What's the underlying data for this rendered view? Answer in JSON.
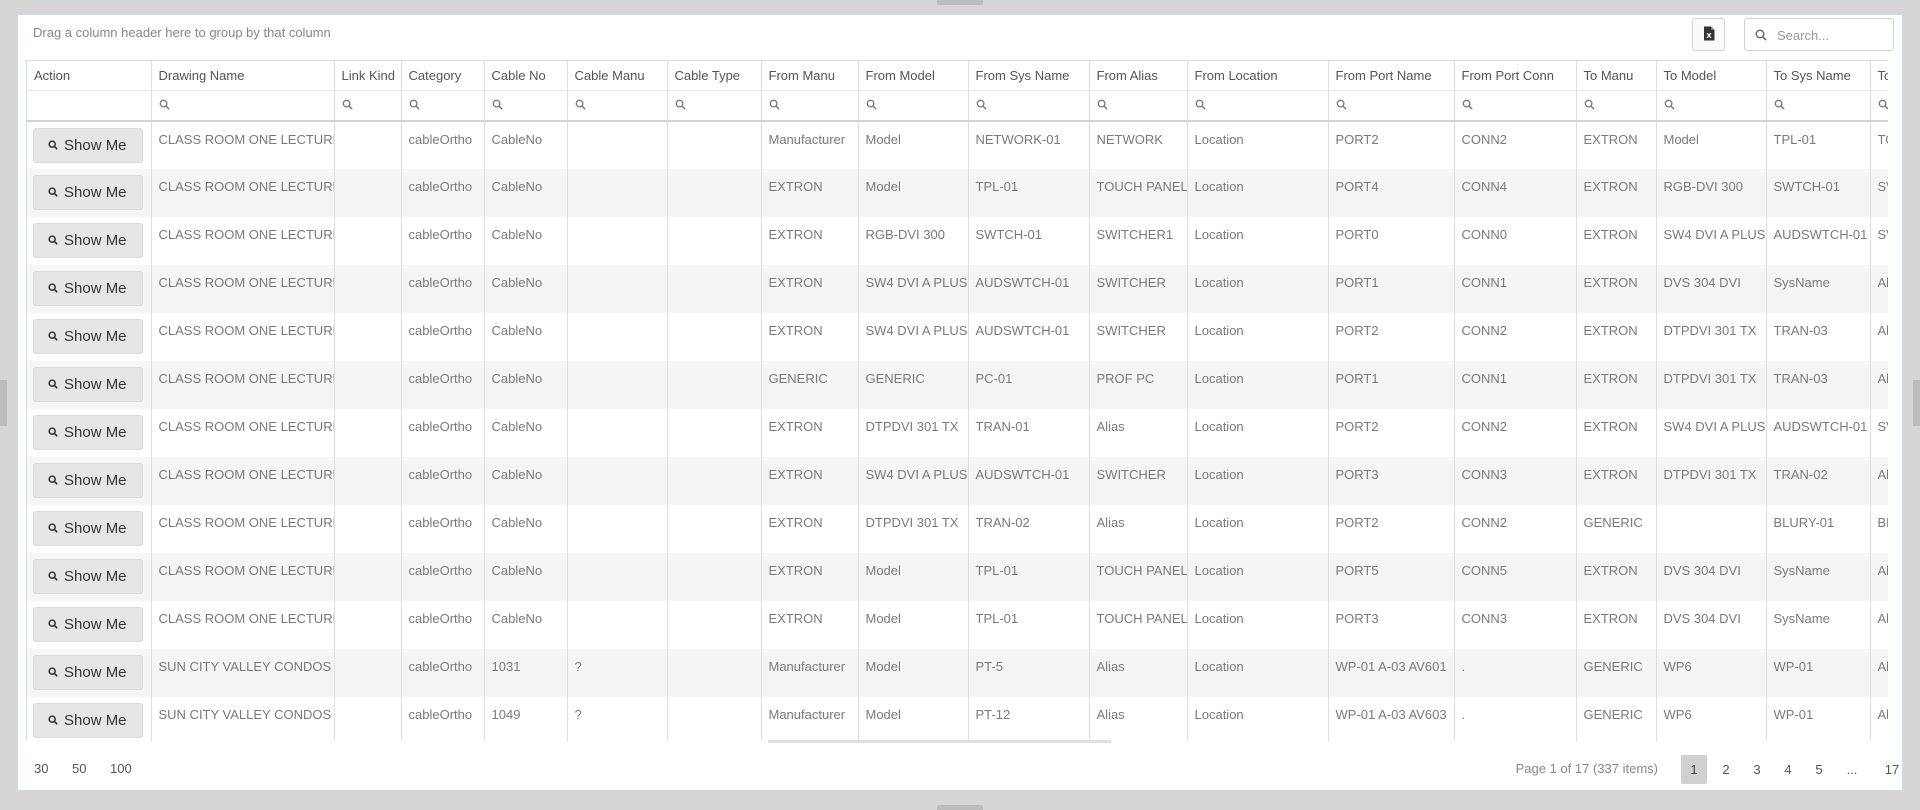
{
  "toolbar": {
    "group_hint": "Drag a column header here to group by that column",
    "search_placeholder": "Search...",
    "excel_icon": "excel-export-icon"
  },
  "columns": [
    "Action",
    "Drawing Name",
    "Link Kind",
    "Category",
    "Cable No",
    "Cable Manu",
    "Cable Type",
    "From Manu",
    "From Model",
    "From Sys Name",
    "From Alias",
    "From Location",
    "From Port Name",
    "From Port Conn",
    "To Manu",
    "To Model",
    "To Sys Name",
    "To"
  ],
  "button_label": "Show Me",
  "rows": [
    [
      "CLASS ROOM ONE LECTURN",
      "",
      "cableOrtho",
      "CableNo",
      "",
      "",
      "Manufacturer",
      "Model",
      "NETWORK-01",
      "NETWORK",
      "Location",
      "PORT2",
      "CONN2",
      "EXTRON",
      "Model",
      "TPL-01",
      "TO"
    ],
    [
      "CLASS ROOM ONE LECTURN",
      "",
      "cableOrtho",
      "CableNo",
      "",
      "",
      "EXTRON",
      "Model",
      "TPL-01",
      "TOUCH PANEL",
      "Location",
      "PORT4",
      "CONN4",
      "EXTRON",
      "RGB-DVI 300",
      "SWTCH-01",
      "SV"
    ],
    [
      "CLASS ROOM ONE LECTURN",
      "",
      "cableOrtho",
      "CableNo",
      "",
      "",
      "EXTRON",
      "RGB-DVI 300",
      "SWTCH-01",
      "SWITCHER1",
      "Location",
      "PORT0",
      "CONN0",
      "EXTRON",
      "SW4 DVI A PLUS",
      "AUDSWTCH-01",
      "SV"
    ],
    [
      "CLASS ROOM ONE LECTURN",
      "",
      "cableOrtho",
      "CableNo",
      "",
      "",
      "EXTRON",
      "SW4 DVI A PLUS",
      "AUDSWTCH-01",
      "SWITCHER",
      "Location",
      "PORT1",
      "CONN1",
      "EXTRON",
      "DVS 304 DVI",
      "SysName",
      "Al"
    ],
    [
      "CLASS ROOM ONE LECTURN",
      "",
      "cableOrtho",
      "CableNo",
      "",
      "",
      "EXTRON",
      "SW4 DVI A PLUS",
      "AUDSWTCH-01",
      "SWITCHER",
      "Location",
      "PORT2",
      "CONN2",
      "EXTRON",
      "DTPDVI 301 TX",
      "TRAN-03",
      "Al"
    ],
    [
      "CLASS ROOM ONE LECTURN",
      "",
      "cableOrtho",
      "CableNo",
      "",
      "",
      "GENERIC",
      "GENERIC",
      "PC-01",
      "PROF PC",
      "Location",
      "PORT1",
      "CONN1",
      "EXTRON",
      "DTPDVI 301 TX",
      "TRAN-03",
      "Al"
    ],
    [
      "CLASS ROOM ONE LECTURN",
      "",
      "cableOrtho",
      "CableNo",
      "",
      "",
      "EXTRON",
      "DTPDVI 301 TX",
      "TRAN-01",
      "Alias",
      "Location",
      "PORT2",
      "CONN2",
      "EXTRON",
      "SW4 DVI A PLUS",
      "AUDSWTCH-01",
      "SV"
    ],
    [
      "CLASS ROOM ONE LECTURN",
      "",
      "cableOrtho",
      "CableNo",
      "",
      "",
      "EXTRON",
      "SW4 DVI A PLUS",
      "AUDSWTCH-01",
      "SWITCHER",
      "Location",
      "PORT3",
      "CONN3",
      "EXTRON",
      "DTPDVI 301 TX",
      "TRAN-02",
      "Al"
    ],
    [
      "CLASS ROOM ONE LECTURN",
      "",
      "cableOrtho",
      "CableNo",
      "",
      "",
      "EXTRON",
      "DTPDVI 301 TX",
      "TRAN-02",
      "Alias",
      "Location",
      "PORT2",
      "CONN2",
      "GENERIC",
      "",
      "BLURY-01",
      "BL"
    ],
    [
      "CLASS ROOM ONE LECTURN",
      "",
      "cableOrtho",
      "CableNo",
      "",
      "",
      "EXTRON",
      "Model",
      "TPL-01",
      "TOUCH PANEL",
      "Location",
      "PORT5",
      "CONN5",
      "EXTRON",
      "DVS 304 DVI",
      "SysName",
      "Al"
    ],
    [
      "CLASS ROOM ONE LECTURN",
      "",
      "cableOrtho",
      "CableNo",
      "",
      "",
      "EXTRON",
      "Model",
      "TPL-01",
      "TOUCH PANEL",
      "Location",
      "PORT3",
      "CONN3",
      "EXTRON",
      "DVS 304 DVI",
      "SysName",
      "Al"
    ],
    [
      "SUN CITY VALLEY CONDOS",
      "",
      "cableOrtho",
      "1031",
      "?",
      "",
      "Manufacturer",
      "Model",
      "PT-5",
      "Alias",
      "Location",
      "WP-01 A-03 AV601",
      ".",
      "GENERIC",
      "WP6",
      "WP-01",
      "Al"
    ],
    [
      "SUN CITY VALLEY CONDOS",
      "",
      "cableOrtho",
      "1049",
      "?",
      "",
      "Manufacturer",
      "Model",
      "PT-12",
      "Alias",
      "Location",
      "WP-01 A-03 AV603",
      ".",
      "GENERIC",
      "WP6",
      "WP-01",
      "Al"
    ]
  ],
  "pager": {
    "sizes": [
      "30",
      "50",
      "100"
    ],
    "info": "Page 1 of 17 (337 items)",
    "pages": [
      "1",
      "2",
      "3",
      "4",
      "5",
      "...",
      "17"
    ],
    "current": "1"
  }
}
